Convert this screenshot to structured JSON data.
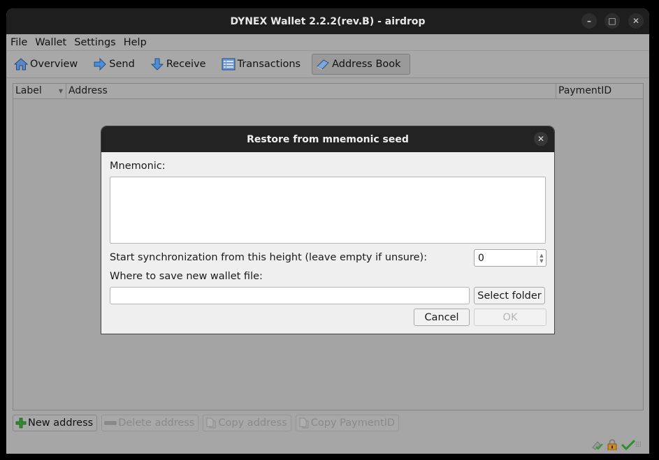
{
  "window": {
    "title": "DYNEX Wallet 2.2.2(rev.B) - airdrop",
    "controls": [
      "minimize",
      "maximize",
      "close"
    ]
  },
  "menu": [
    "File",
    "Wallet",
    "Settings",
    "Help"
  ],
  "toolbar": {
    "items": [
      {
        "label": "Overview",
        "icon": "home-icon",
        "active": false
      },
      {
        "label": "Send",
        "icon": "arrow-right-icon",
        "active": false
      },
      {
        "label": "Receive",
        "icon": "arrow-down-icon",
        "active": false
      },
      {
        "label": "Transactions",
        "icon": "list-icon",
        "active": false
      },
      {
        "label": "Address Book",
        "icon": "address-book-icon",
        "active": true
      }
    ]
  },
  "table": {
    "columns": [
      "Label",
      "Address",
      "PaymentID"
    ],
    "sort_column": "Label",
    "rows": []
  },
  "bottom_buttons": [
    {
      "label": "New address",
      "icon": "plus-icon",
      "enabled": true
    },
    {
      "label": "Delete address",
      "icon": "delete-icon",
      "enabled": false
    },
    {
      "label": "Copy address",
      "icon": "copy-icon",
      "enabled": false
    },
    {
      "label": "Copy PaymentID",
      "icon": "copy-icon",
      "enabled": false
    }
  ],
  "status_icons": [
    "connected-icon",
    "lock-icon",
    "synced-check-icon"
  ],
  "dialog": {
    "title": "Restore from mnemonic seed",
    "mnemonic_label": "Mnemonic:",
    "mnemonic_value": "",
    "height_label": "Start synchronization from this height (leave empty if unsure):",
    "height_value": "0",
    "path_label": "Where to save new wallet file:",
    "path_value": "",
    "select_folder_label": "Select folder",
    "cancel_label": "Cancel",
    "ok_label": "OK",
    "ok_enabled": false
  }
}
